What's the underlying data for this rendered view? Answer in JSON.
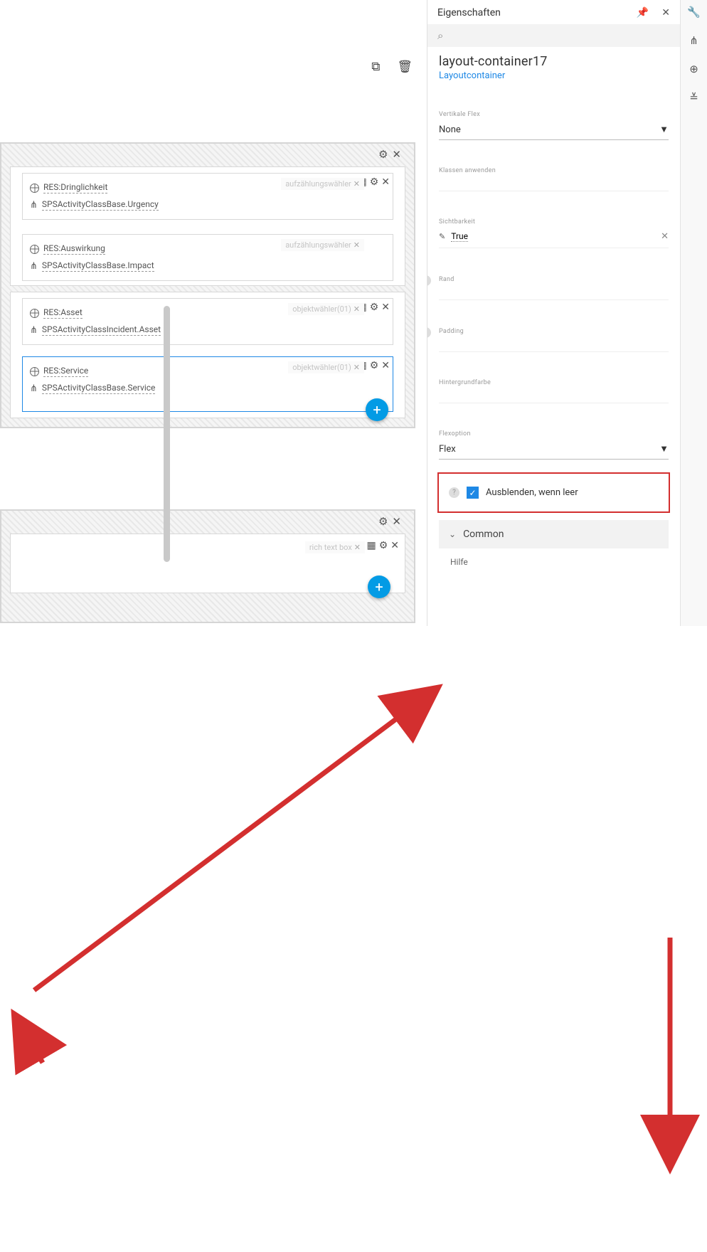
{
  "properties_panel": {
    "header": "Eigenschaften",
    "title": "layout-container17",
    "subtitle": "Layoutcontainer",
    "fields": {
      "vertical_flex": {
        "label": "Vertikale Flex",
        "value": "None"
      },
      "apply_classes": {
        "label": "Klassen anwenden"
      },
      "visibility": {
        "label": "Sichtbarkeit",
        "value": "True"
      },
      "border": {
        "label": "Rand"
      },
      "padding": {
        "label": "Padding"
      },
      "bg_color": {
        "label": "Hintergrundfarbe"
      },
      "flex_option": {
        "label": "Flexoption",
        "value": "Flex"
      },
      "hide_when_empty": {
        "label": "Ausblenden, wenn leer",
        "checked": true
      }
    },
    "section_common": "Common",
    "help": "Hilfe"
  },
  "canvas": {
    "fields": [
      {
        "res_label": "RES:Dringlichkeit",
        "binding": "SPSActivityClassBase.Urgency",
        "type_tag": "aufzählungswähler"
      },
      {
        "res_label": "RES:Auswirkung",
        "binding": "SPSActivityClassBase.Impact",
        "type_tag": "aufzählungswähler"
      },
      {
        "res_label": "RES:Asset",
        "binding": "SPSActivityClassIncident.Asset",
        "type_tag": "objektwähler(01)"
      },
      {
        "res_label": "RES:Service",
        "binding": "SPSActivityClassBase.Service",
        "type_tag": "objektwähler(01)"
      }
    ],
    "rich_text_tag": "rich text box"
  },
  "icons": {
    "gear": "⚙",
    "close": "✕",
    "layout": "▦",
    "plus": "+",
    "search": "🔍",
    "pin": "📌",
    "dropdown": "▼",
    "pencil": "✎",
    "check": "✓",
    "chevron_down": "⌄",
    "wrench": "🔧",
    "tree": "⋔",
    "globe": "🌐",
    "sliders": "≣",
    "copy": "⧉",
    "delete": "🗑"
  }
}
